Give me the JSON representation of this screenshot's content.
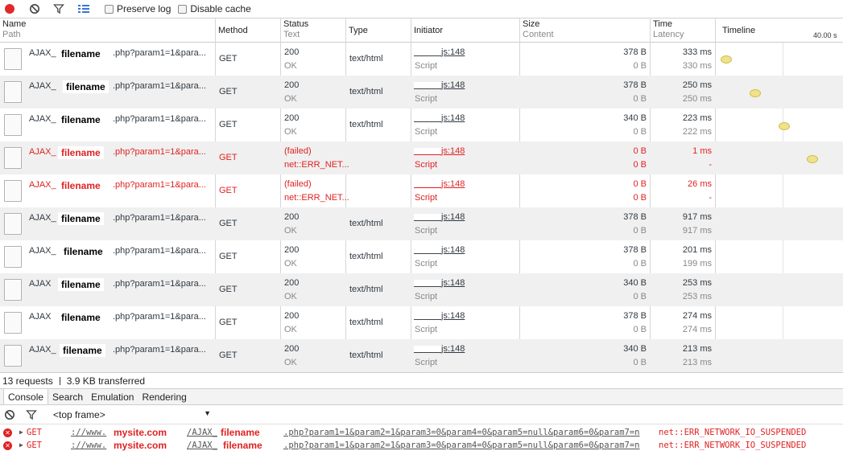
{
  "toolbar": {
    "preserve_log_label": "Preserve log",
    "disable_cache_label": "Disable cache"
  },
  "columns": {
    "name": "Name",
    "path": "Path",
    "method": "Method",
    "status": "Status",
    "text": "Text",
    "type": "Type",
    "initiator": "Initiator",
    "size": "Size",
    "content": "Content",
    "time": "Time",
    "latency": "Latency",
    "timeline": "Timeline",
    "timeline_marker": "40.00 s"
  },
  "rows": [
    {
      "name_prefix": "AJAX_",
      "filename": "filename",
      "name_suffix": ".php?param1=1&para...",
      "method": "GET",
      "status": "200",
      "status_text": "OK",
      "type": "text/html",
      "initiator": "js:148",
      "initiator_type": "Script",
      "size": "378 B",
      "content": "0 B",
      "time": "333 ms",
      "latency": "330 ms",
      "failed": false
    },
    {
      "name_prefix": "AJAX_",
      "filename": "filename",
      "name_suffix": ".php?param1=1&para...",
      "method": "GET",
      "status": "200",
      "status_text": "OK",
      "type": "text/html",
      "initiator": "js:148",
      "initiator_type": "Script",
      "size": "378 B",
      "content": "0 B",
      "time": "250 ms",
      "latency": "250 ms",
      "failed": false
    },
    {
      "name_prefix": "AJAX_",
      "filename": "filename",
      "name_suffix": ".php?param1=1&para...",
      "method": "GET",
      "status": "200",
      "status_text": "OK",
      "type": "text/html",
      "initiator": "js:148",
      "initiator_type": "Script",
      "size": "340 B",
      "content": "0 B",
      "time": "223 ms",
      "latency": "222 ms",
      "failed": false
    },
    {
      "name_prefix": "AJAX_",
      "filename": "filename",
      "name_suffix": ".php?param1=1&para...",
      "method": "GET",
      "status": "(failed)",
      "status_text": "net::ERR_NET...",
      "type": "",
      "initiator": "js:148",
      "initiator_type": "Script",
      "size": "0 B",
      "content": "0 B",
      "time": "1 ms",
      "latency": "-",
      "failed": true
    },
    {
      "name_prefix": "AJAX_",
      "filename": "filename",
      "name_suffix": ".php?param1=1&para...",
      "method": "GET",
      "status": "(failed)",
      "status_text": "net::ERR_NET...",
      "type": "",
      "initiator": "js:148",
      "initiator_type": "Script",
      "size": "0 B",
      "content": "0 B",
      "time": "26 ms",
      "latency": "-",
      "failed": true
    },
    {
      "name_prefix": "AJAX_",
      "filename": "filename",
      "name_suffix": ".php?param1=1&para...",
      "method": "GET",
      "status": "200",
      "status_text": "OK",
      "type": "text/html",
      "initiator": "js:148",
      "initiator_type": "Script",
      "size": "378 B",
      "content": "0 B",
      "time": "917 ms",
      "latency": "917 ms",
      "failed": false
    },
    {
      "name_prefix": "AJAX_",
      "filename": "filename",
      "name_suffix": ".php?param1=1&para...",
      "method": "GET",
      "status": "200",
      "status_text": "OK",
      "type": "text/html",
      "initiator": "js:148",
      "initiator_type": "Script",
      "size": "378 B",
      "content": "0 B",
      "time": "201 ms",
      "latency": "199 ms",
      "failed": false
    },
    {
      "name_prefix": "AJAX",
      "filename": "filename",
      "name_suffix": ".php?param1=1&para...",
      "method": "GET",
      "status": "200",
      "status_text": "OK",
      "type": "text/html",
      "initiator": "js:148",
      "initiator_type": "Script",
      "size": "340 B",
      "content": "0 B",
      "time": "253 ms",
      "latency": "253 ms",
      "failed": false
    },
    {
      "name_prefix": "AJAX",
      "filename": "filename",
      "name_suffix": ".php?param1=1&para...",
      "method": "GET",
      "status": "200",
      "status_text": "OK",
      "type": "text/html",
      "initiator": "js:148",
      "initiator_type": "Script",
      "size": "378 B",
      "content": "0 B",
      "time": "274 ms",
      "latency": "274 ms",
      "failed": false
    },
    {
      "name_prefix": "AJAX_",
      "filename": "filename",
      "name_suffix": ".php?param1=1&para...",
      "method": "GET",
      "status": "200",
      "status_text": "OK",
      "type": "text/html",
      "initiator": "js:148",
      "initiator_type": "Script",
      "size": "340 B",
      "content": "0 B",
      "time": "213 ms",
      "latency": "213 ms",
      "failed": false
    }
  ],
  "status_bar": {
    "requests": "13 requests",
    "transferred": "3.9 KB transferred"
  },
  "drawer_tabs": [
    "Console",
    "Search",
    "Emulation",
    "Rendering"
  ],
  "console": {
    "frame_select": "<top frame>",
    "messages": [
      {
        "method": "GET",
        "scheme": "://www.",
        "site": "mysite.com",
        "path": "/AJAX_",
        "filename": "filename",
        "query": ".php?param1=1&param2=1&param3=0&param4=0&param5=null&param6=0&param7=n",
        "error": "net::ERR_NETWORK_IO_SUSPENDED"
      },
      {
        "method": "GET",
        "scheme": "://www.",
        "site": "mysite.com",
        "path": "/AJAX_",
        "filename": "filename",
        "query": ".php?param1=1&param2=1&param3=0&param4=0&param5=null&param6=0&param7=n",
        "error": "net::ERR_NETWORK_IO_SUSPENDED"
      }
    ]
  },
  "colors": {
    "error_red": "#e02222",
    "timeline_bubble": "#efe28a",
    "record_red": "#e02929"
  }
}
